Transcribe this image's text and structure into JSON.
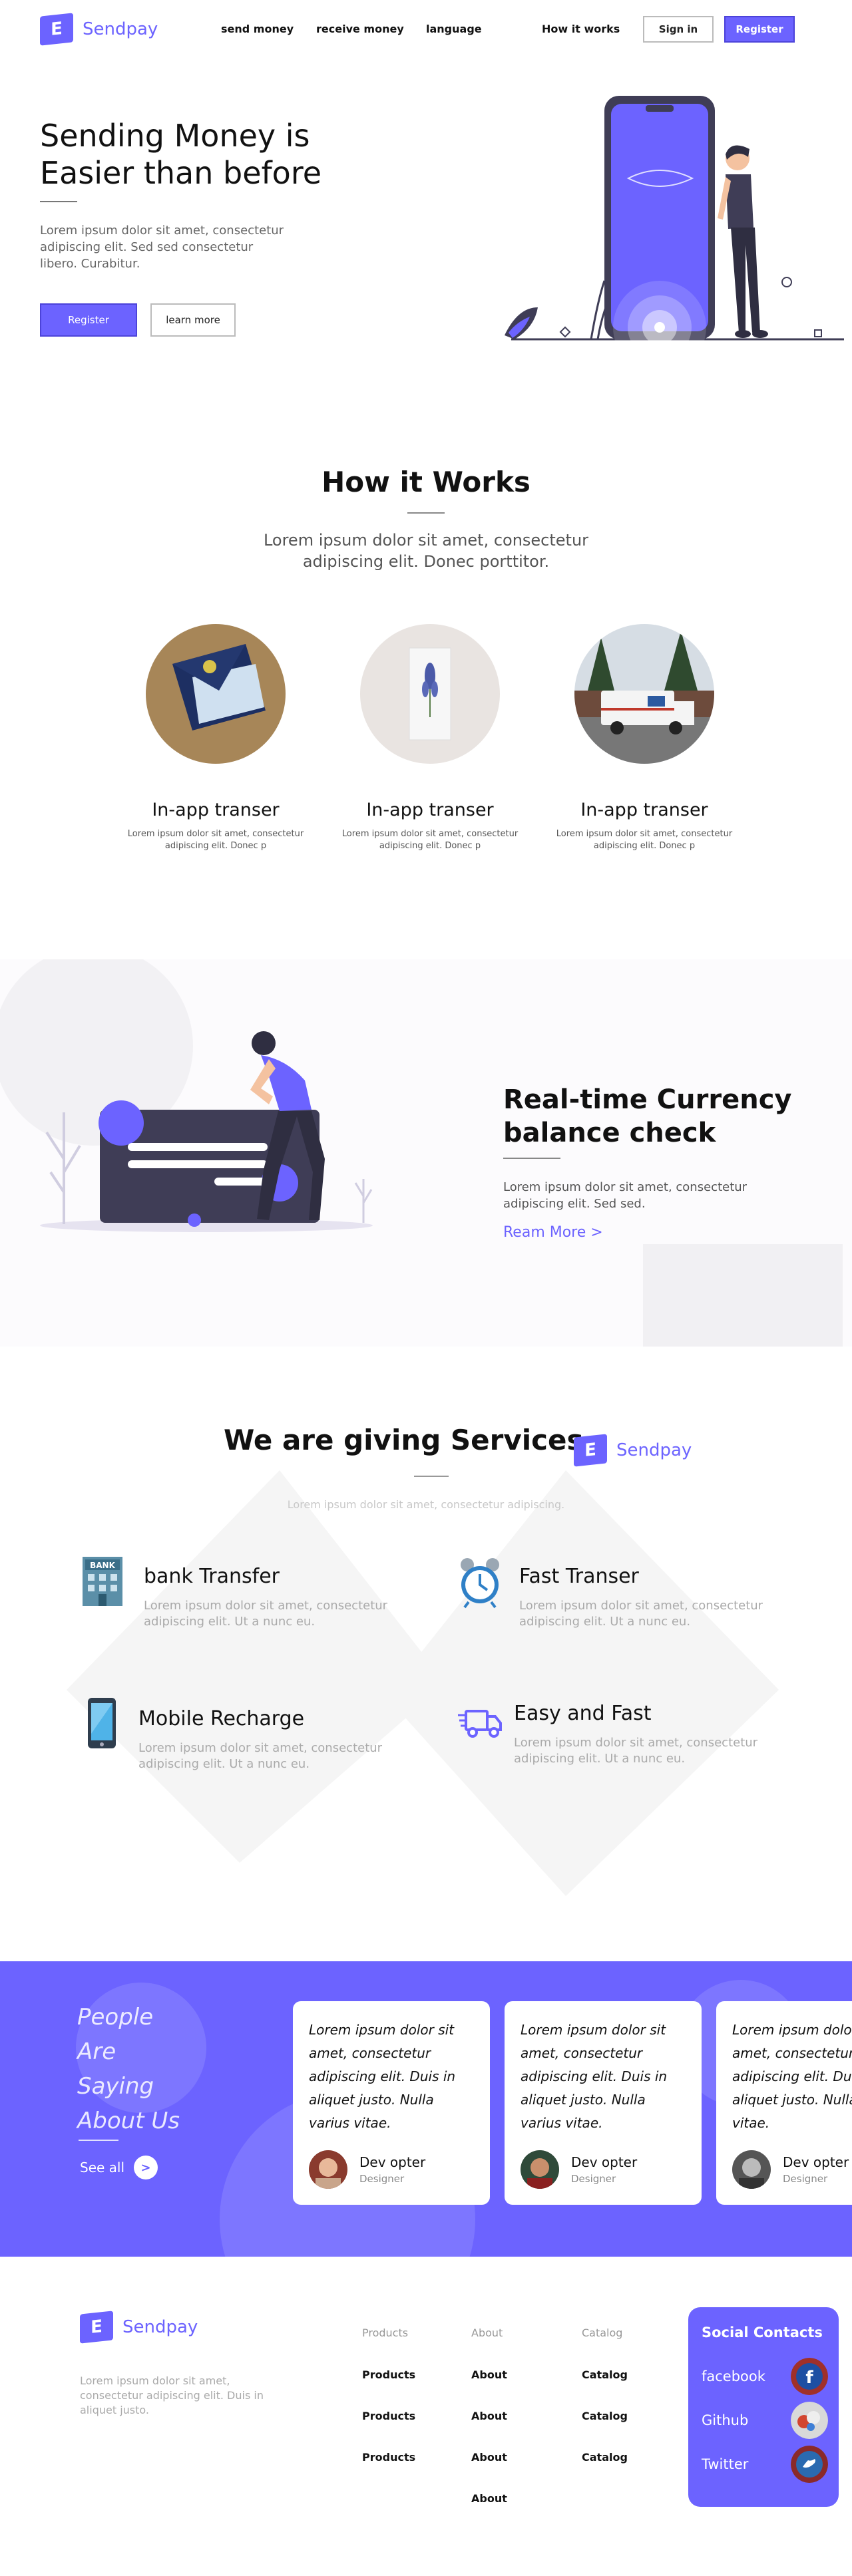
{
  "nav": {
    "brand": "Sendpay",
    "brand_letter": "E",
    "links": [
      "send money",
      "receive money",
      "language"
    ],
    "how_it_works": "How it works",
    "sign_in": "Sign in",
    "register": "Register"
  },
  "hero": {
    "title": "Sending Money is Easier than before",
    "text": "Lorem ipsum dolor sit amet, consectetur adipiscing elit. Sed sed consectetur libero. Curabitur.",
    "register": "Register",
    "learn_more": "learn more"
  },
  "how_it_works": {
    "title": "How it Works",
    "subtitle": "Lorem ipsum dolor sit amet, consectetur adipiscing elit. Donec porttitor.",
    "steps": [
      {
        "title": "In-app transer",
        "text": "Lorem ipsum dolor sit amet, consectetur adipiscing elit. Donec p"
      },
      {
        "title": "In-app transer",
        "text": "Lorem ipsum dolor sit amet, consectetur adipiscing elit. Donec p"
      },
      {
        "title": "In-app transer",
        "text": "Lorem ipsum dolor sit amet, consectetur adipiscing elit. Donec p"
      }
    ]
  },
  "currency": {
    "title": "Real-time Currency balance check",
    "text": "Lorem ipsum dolor sit amet, consectetur adipiscing elit. Sed sed.",
    "link": "Ream More >"
  },
  "services": {
    "title": "We are giving Services",
    "brand": "Sendpay",
    "brand_letter": "E",
    "subtitle": "Lorem ipsum dolor sit amet, consectetur adipiscing.",
    "items": [
      {
        "name": "bank Transfer",
        "text": "Lorem ipsum dolor sit amet, consectetur adipiscing elit. Ut a nunc eu.",
        "icon": "bank-icon"
      },
      {
        "name": "Fast Transer",
        "text": "Lorem ipsum dolor sit amet, consectetur adipiscing elit. Ut a nunc eu.",
        "icon": "alarm-clock-icon"
      },
      {
        "name": "Mobile Recharge",
        "text": "Lorem ipsum dolor sit amet, consectetur adipiscing elit. Ut a nunc eu.",
        "icon": "smartphone-icon"
      },
      {
        "name": "Easy and Fast",
        "text": "Lorem ipsum dolor sit amet, consectetur adipiscing elit. Ut a nunc eu.",
        "icon": "delivery-truck-icon"
      }
    ],
    "bank_sign": "BANK"
  },
  "testimonials": {
    "heading_lines": [
      "People",
      "Are",
      "Saying",
      "About Us"
    ],
    "see_all": "See all",
    "see_all_arrow": ">",
    "cards": [
      {
        "quote": "Lorem ipsum dolor sit amet, consectetur adipiscing elit. Duis in aliquet justo. Nulla varius vitae.",
        "name": "Dev opter",
        "role": "Designer"
      },
      {
        "quote": "Lorem ipsum dolor sit amet, consectetur adipiscing elit. Duis in aliquet justo. Nulla varius vitae.",
        "name": "Dev opter",
        "role": "Designer"
      },
      {
        "quote": "Lorem ipsum dolor sit amet, consectetur adipiscing elit. Duis in aliquet justo. Nulla varius vitae.",
        "name": "Dev opter",
        "role": "Designer"
      }
    ]
  },
  "footer": {
    "brand": "Sendpay",
    "brand_letter": "E",
    "text": "Lorem ipsum dolor sit amet, consectetur adipiscing elit. Duis in aliquet justo.",
    "columns": [
      {
        "head": "Products",
        "items": [
          "Products",
          "Products",
          "Products"
        ]
      },
      {
        "head": "About",
        "items": [
          "About",
          "About",
          "About",
          "About"
        ]
      },
      {
        "head": "Catalog",
        "items": [
          "Catalog",
          "Catalog",
          "Catalog"
        ]
      }
    ],
    "social": {
      "title": "Social Contacts",
      "items": [
        {
          "label": "facebook",
          "icon": "facebook-icon"
        },
        {
          "label": "Github",
          "icon": "github-icon"
        },
        {
          "label": "Twitter",
          "icon": "twitter-icon"
        }
      ]
    }
  },
  "colors": {
    "accent": "#6c63ff",
    "dark": "#3f3d56"
  }
}
